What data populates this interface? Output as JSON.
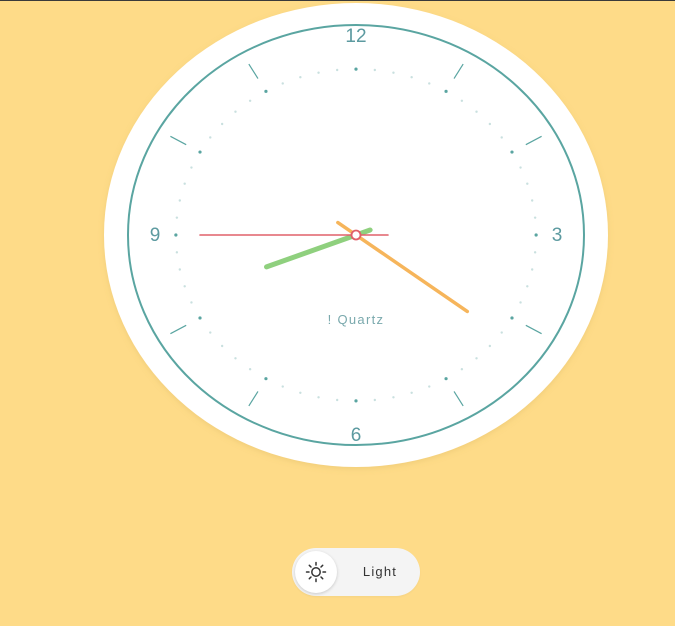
{
  "clock": {
    "numerals": {
      "top": "12",
      "right": "3",
      "bottom": "6",
      "left": "9"
    },
    "brand": "! Quartz",
    "time": {
      "hours": 8,
      "minutes": 20,
      "seconds": 45
    },
    "colors": {
      "face": "#ffffff",
      "ring": "#5aa5a1",
      "tick": "#5aa5a1",
      "hour_hand": "#8fd07e",
      "minute_hand": "#f6b55b",
      "second_hand": "#e0606a",
      "numeral": "#5c9aa0",
      "brand_text": "#7aa9ad"
    }
  },
  "theme_toggle": {
    "label": "Light",
    "icon": "sun-icon"
  },
  "colors": {
    "background": "#FEDB88",
    "toggle_track": "#f4f4f4"
  }
}
